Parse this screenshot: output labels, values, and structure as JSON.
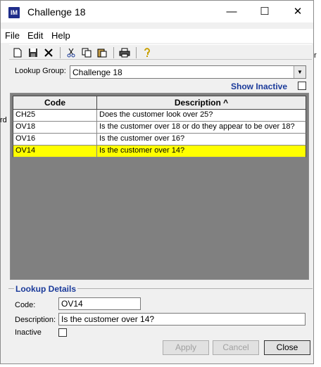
{
  "window": {
    "title": "Challenge 18",
    "app_icon_text": "IM",
    "controls": {
      "minimize": "—",
      "maximize": "☐",
      "close": "✕"
    }
  },
  "menu": [
    "File",
    "Edit",
    "Help"
  ],
  "toolbar": {
    "buttons": [
      "new-icon",
      "save-icon",
      "delete-icon",
      "cut-icon",
      "copy-icon",
      "paste-icon",
      "print-icon",
      "help-icon"
    ]
  },
  "lookup": {
    "label": "Lookup Group:",
    "value": "Challenge 18",
    "show_inactive_label": "Show Inactive"
  },
  "grid": {
    "columns": [
      "Code",
      "Description ^"
    ],
    "rows": [
      {
        "code": "CH25",
        "description": "Does the customer look over 25?",
        "selected": false
      },
      {
        "code": "OV18",
        "description": "Is the customer over 18 or do they appear to be over 18?",
        "selected": false
      },
      {
        "code": "OV16",
        "description": "Is the customer over 16?",
        "selected": false
      },
      {
        "code": "OV14",
        "description": "Is the customer over 14?",
        "selected": true
      }
    ]
  },
  "details": {
    "legend": "Lookup Details",
    "code_label": "Code:",
    "code_value": "OV14",
    "description_label": "Description:",
    "description_value": "Is the customer over 14?",
    "inactive_label": "Inactive"
  },
  "buttons": {
    "apply": "Apply",
    "cancel": "Cancel",
    "close": "Close"
  },
  "background_fragments": {
    "left": "rd"
  },
  "colors": {
    "selected_row": "#ffff00",
    "grid_background": "#808080",
    "accent_text": "#1a3a9a"
  }
}
